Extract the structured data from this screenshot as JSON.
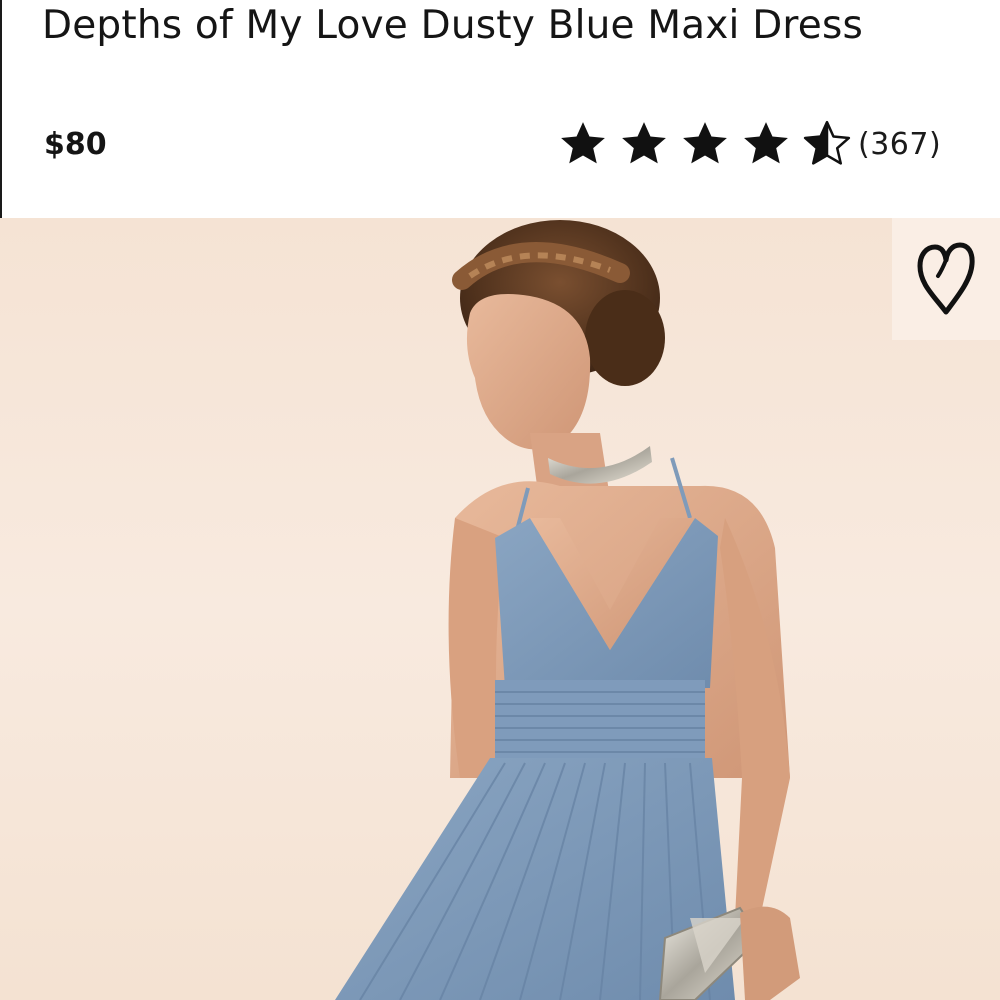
{
  "product": {
    "title": "Depths of My Love Dusty Blue Maxi Dress",
    "price": "$80",
    "rating": {
      "stars": 4.5,
      "max_stars": 5,
      "review_count": "(367)"
    }
  },
  "image": {
    "wishlist_icon": "heart-outline-icon",
    "dress_color": "#7b98b8"
  },
  "colors": {
    "text": "#151515",
    "star": "#111111",
    "background": "#ffffff",
    "photo_backdrop": "#f6e6d8"
  }
}
